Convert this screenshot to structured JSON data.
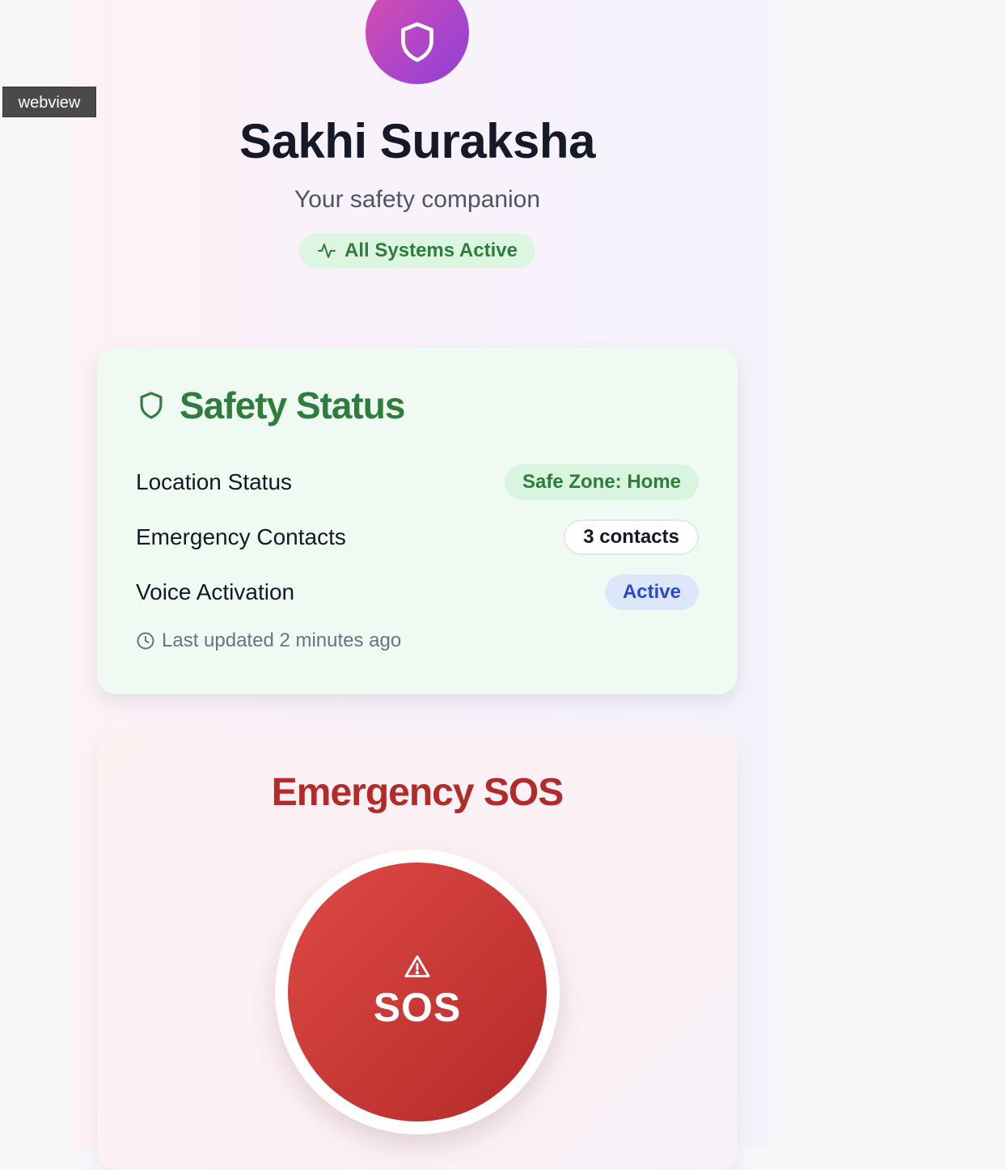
{
  "overlay": {
    "webview_label": "webview"
  },
  "header": {
    "logo_icon": "shield-icon",
    "title": "Sakhi Suraksha",
    "subtitle": "Your safety companion",
    "status_badge": {
      "icon": "activity-icon",
      "label": "All Systems Active"
    }
  },
  "safety_status": {
    "icon": "shield-icon",
    "title": "Safety Status",
    "rows": [
      {
        "label": "Location Status",
        "value": "Safe Zone: Home",
        "style": "green"
      },
      {
        "label": "Emergency Contacts",
        "value": "3 contacts",
        "style": "outline"
      },
      {
        "label": "Voice Activation",
        "value": "Active",
        "style": "blue"
      }
    ],
    "last_updated": {
      "icon": "clock-icon",
      "text": "Last updated 2 minutes ago"
    }
  },
  "emergency": {
    "title": "Emergency SOS",
    "button_icon": "warning-triangle-icon",
    "button_label": "SOS"
  },
  "colors": {
    "brand_gradient_start": "#d94fb0",
    "brand_gradient_end": "#8e3fd9",
    "safe_green": "#2f7d3c",
    "active_blue": "#2a49c8",
    "sos_red": "#b32a2a"
  }
}
